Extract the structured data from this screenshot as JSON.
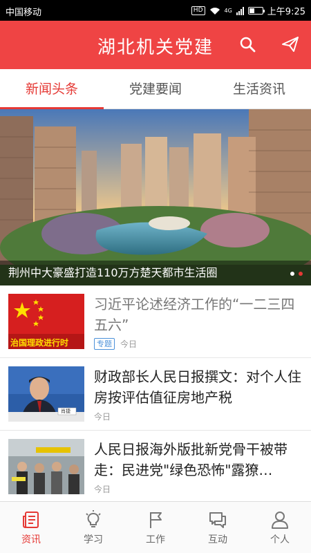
{
  "status": {
    "carrier": "中国移动",
    "hd": "HD",
    "network": "4G",
    "time": "上午9:25"
  },
  "header": {
    "title": "湖北机关党建",
    "search_icon": "search-icon",
    "send_icon": "send-icon"
  },
  "tabs": [
    {
      "label": "新闻头条",
      "active": true
    },
    {
      "label": "党建要闻",
      "active": false
    },
    {
      "label": "生活资讯",
      "active": false
    }
  ],
  "hero": {
    "caption": "荆州中大豪盛打造110万方楚天都市生活圈",
    "slides": 2,
    "current_slide": 2
  },
  "news": [
    {
      "title": "习近平论述经济工作的“一二三四五六”",
      "tag": "专题",
      "date": "今日",
      "thumb_text": "治国理政进行时",
      "read": true
    },
    {
      "title": "财政部长人民日报撰文：对个人住房按评估值征房地产税",
      "tag": "",
      "date": "今日",
      "thumb_text": "肖捷",
      "read": false
    },
    {
      "title": "人民日报海外版批新党骨干被带走：民进党\"绿色恐怖\"露獠…",
      "tag": "",
      "date": "今日",
      "thumb_text": "",
      "read": false
    }
  ],
  "nav": [
    {
      "label": "资讯",
      "icon": "news-icon",
      "active": true
    },
    {
      "label": "学习",
      "icon": "bulb-icon",
      "active": false
    },
    {
      "label": "工作",
      "icon": "flag-icon",
      "active": false
    },
    {
      "label": "互动",
      "icon": "chat-icon",
      "active": false
    },
    {
      "label": "个人",
      "icon": "person-icon",
      "active": false
    }
  ],
  "colors": {
    "brand": "#ef4444",
    "accent": "#e53935",
    "tag": "#4a90d9"
  }
}
